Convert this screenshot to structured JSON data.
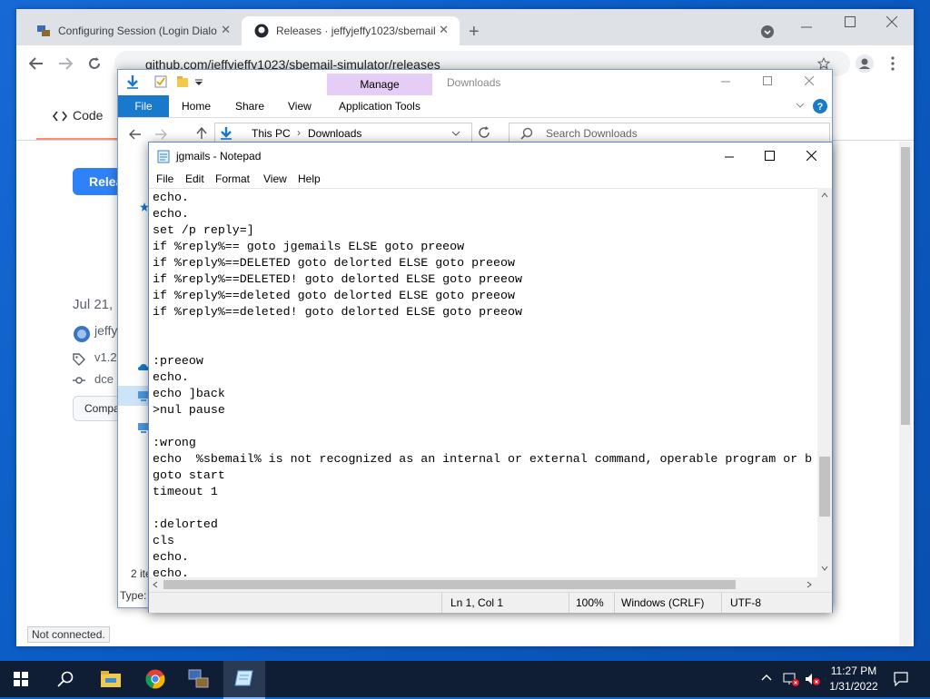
{
  "browser": {
    "tabs": [
      {
        "title": "Configuring Session (Login Dialo",
        "close": "✕"
      },
      {
        "title": "Releases · jeffyjeffy1023/sbemail",
        "close": "✕"
      }
    ],
    "new_tab": "+",
    "url": "github.com/jeffyjeffy1023/sbemail-simulator/releases"
  },
  "github": {
    "code_tab": "Code",
    "release_button": "Relea",
    "date": "Jul 21,",
    "user": "jeffy",
    "tag": "v1.2",
    "commit": "dce",
    "compare": "Compa"
  },
  "explorer": {
    "ribbon_tabs": [
      "File",
      "Home",
      "Share",
      "View",
      "Application Tools"
    ],
    "manage": "Manage",
    "title": "Downloads",
    "breadcrumb": [
      "This PC",
      "Downloads"
    ],
    "search_placeholder": "Search Downloads",
    "items_count": "2 ite",
    "type_label": "Type:"
  },
  "notepad": {
    "title": "jgmails - Notepad",
    "menu": [
      "File",
      "Edit",
      "Format",
      "View",
      "Help"
    ],
    "content": "echo.\necho.\nset /p reply=]\nif %reply%== goto jgemails ELSE goto preeow\nif %reply%==DELETED goto delorted ELSE goto preeow\nif %reply%==DELETED! goto delorted ELSE goto preeow\nif %reply%==deleted goto delorted ELSE goto preeow\nif %reply%==deleted! goto delorted ELSE goto preeow\n\n\n:preeow\necho.\necho ]back\n>nul pause\n\n:wrong\necho  %sbemail% is not recognized as an internal or external command, operable program or b\ngoto start\ntimeout 1\n\n:delorted\ncls\necho.\necho.",
    "status": {
      "position": "Ln 1, Col 1",
      "zoom": "100%",
      "line_ending": "Windows (CRLF)",
      "encoding": "UTF-8"
    }
  },
  "status_bar_text": "Not connected.",
  "taskbar": {
    "time": "11:27 PM",
    "date": "1/31/2022"
  },
  "colors": {
    "github_blue": "#2f81f7",
    "explorer_file": "#1979ca",
    "manage_tab": "#e6cdf5",
    "taskbar": "#101e35"
  }
}
